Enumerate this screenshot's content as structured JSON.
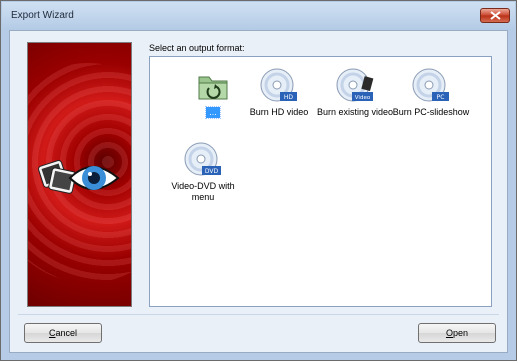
{
  "window": {
    "title": "Export Wizard"
  },
  "main": {
    "section_label": "Select an output format:",
    "formats": [
      {
        "label": "...",
        "icon": "folder-back-icon",
        "selected": true
      },
      {
        "label": "Burn HD video",
        "icon": "hd-disc-icon",
        "badge": "HD"
      },
      {
        "label": "Burn existing video",
        "icon": "video-disc-icon",
        "badge": "Video"
      },
      {
        "label": "Burn PC-slideshow",
        "icon": "pc-disc-icon",
        "badge": "PC"
      },
      {
        "label": "Video-DVD with menu",
        "icon": "dvd-disc-icon",
        "badge": "DVD"
      }
    ]
  },
  "footer": {
    "cancel_label_first": "C",
    "cancel_label_rest": "ancel",
    "open_label_first": "O",
    "open_label_rest": "pen"
  },
  "colors": {
    "accent_selection": "#3399ff",
    "side_panel": "#c41010",
    "disc_badge": "#2a62b8"
  }
}
